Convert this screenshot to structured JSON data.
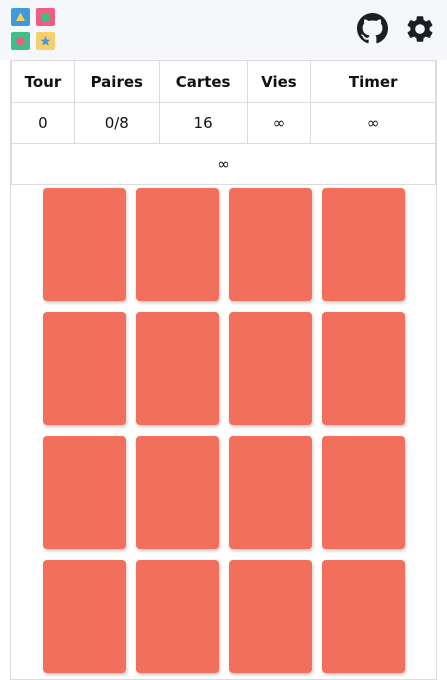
{
  "header": {
    "logo_icon": "memory-game-logo",
    "github_icon": "github-icon",
    "settings_icon": "gear-icon"
  },
  "stats": {
    "columns": [
      "Tour",
      "Paires",
      "Cartes",
      "Vies",
      "Timer"
    ],
    "values": [
      "0",
      "0/8",
      "16",
      "∞",
      "∞"
    ],
    "extra": "∞"
  },
  "board": {
    "card_count": 16,
    "card_back_color": "#f26f5b"
  },
  "colors": {
    "logo_blue": "#3f9be0",
    "logo_pink": "#ef5e7e",
    "logo_green": "#3fbf87",
    "logo_yellow": "#f7cf6d"
  }
}
